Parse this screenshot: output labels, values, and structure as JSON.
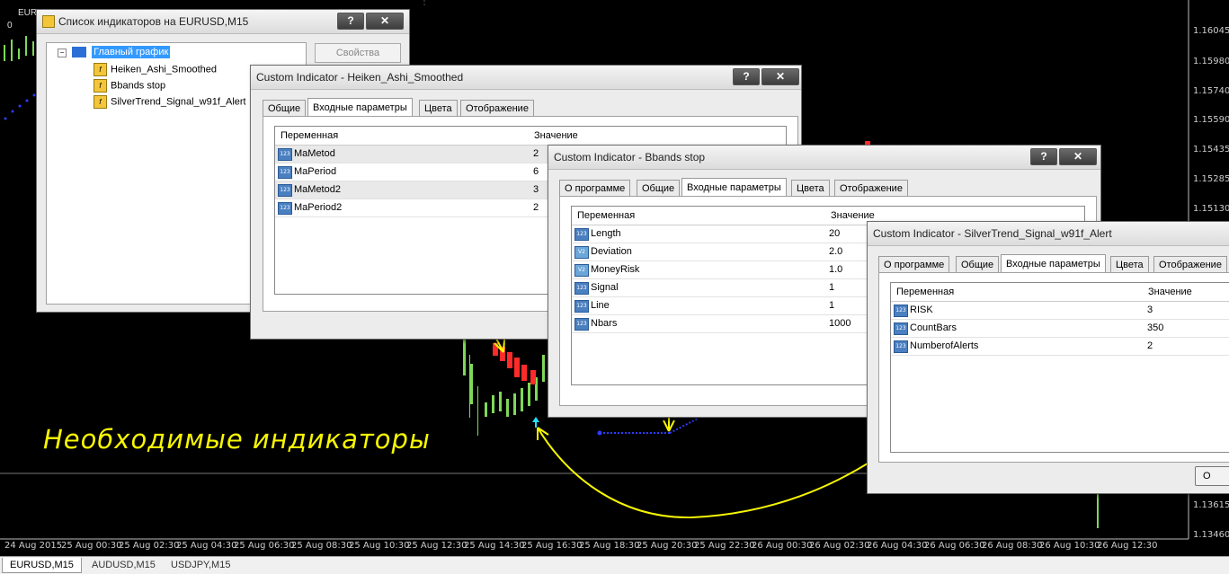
{
  "chart": {
    "symbol": "EURUSD",
    "zero_label": "0",
    "prices": [
      "1.16045",
      "1.15980",
      "1.15740",
      "1.15590",
      "1.15435",
      "1.15285",
      "1.15130",
      "1.13615",
      "1.13460"
    ],
    "times": [
      "24 Aug 2015",
      "25 Aug 00:30",
      "25 Aug 02:30",
      "25 Aug 04:30",
      "25 Aug 06:30",
      "25 Aug 08:30",
      "25 Aug 10:30",
      "25 Aug 12:30",
      "25 Aug 14:30",
      "25 Aug 16:30",
      "25 Aug 18:30",
      "25 Aug 20:30",
      "25 Aug 22:30",
      "26 Aug 00:30",
      "26 Aug 02:30",
      "26 Aug 04:30",
      "26 Aug 06:30",
      "26 Aug 08:30",
      "26 Aug 10:30",
      "26 Aug 12:30"
    ],
    "overlay_caption": "Необходимые индикаторы"
  },
  "symbol_tabs": [
    "EURUSD,M15",
    "AUDUSD,M15",
    "USDJPY,M15"
  ],
  "list_window": {
    "title": "Список индикаторов на EURUSD,M15",
    "help": "?",
    "close": "✕",
    "root": "Главный график",
    "items": [
      "Heiken_Ashi_Smoothed",
      "Bbands stop",
      "SilverTrend_Signal_w91f_Alert"
    ],
    "properties_button": "Свойства"
  },
  "heiken_window": {
    "title": "Custom Indicator - Heiken_Ashi_Smoothed",
    "help": "?",
    "close": "✕",
    "tabs": [
      "Общие",
      "Входные параметры",
      "Цвета",
      "Отображение"
    ],
    "col_variable": "Переменная",
    "col_value": "Значение",
    "rows": [
      {
        "name": "MaMetod",
        "value": "2",
        "icon": "123"
      },
      {
        "name": "MaPeriod",
        "value": "6",
        "icon": "123"
      },
      {
        "name": "MaMetod2",
        "value": "3",
        "icon": "123"
      },
      {
        "name": "MaPeriod2",
        "value": "2",
        "icon": "123"
      }
    ]
  },
  "bbands_window": {
    "title": "Custom Indicator - Bbands stop",
    "help": "?",
    "close": "✕",
    "tabs": [
      "О программе",
      "Общие",
      "Входные параметры",
      "Цвета",
      "Отображение"
    ],
    "col_variable": "Переменная",
    "col_value": "Значение",
    "rows": [
      {
        "name": "Length",
        "value": "20",
        "icon": "123"
      },
      {
        "name": "Deviation",
        "value": "2.0",
        "icon": "V2"
      },
      {
        "name": "MoneyRisk",
        "value": "1.0",
        "icon": "V2"
      },
      {
        "name": "Signal",
        "value": "1",
        "icon": "123"
      },
      {
        "name": "Line",
        "value": "1",
        "icon": "123"
      },
      {
        "name": "Nbars",
        "value": "1000",
        "icon": "123"
      }
    ]
  },
  "silver_window": {
    "title": "Custom Indicator - SilverTrend_Signal_w91f_Alert",
    "tabs": [
      "О программе",
      "Общие",
      "Входные параметры",
      "Цвета",
      "Отображение"
    ],
    "col_variable": "Переменная",
    "col_value": "Значение",
    "rows": [
      {
        "name": "RISK",
        "value": "3",
        "icon": "123"
      },
      {
        "name": "CountBars",
        "value": "350",
        "icon": "123"
      },
      {
        "name": "NumberofAlerts",
        "value": "2",
        "icon": "123"
      }
    ],
    "ok_button": "O"
  },
  "colors": {
    "chart_bg": "#000000",
    "bull": "#7ed957",
    "bear": "#ff2a2a",
    "signal_line": "#2d3cff",
    "arrow": "#ffff33"
  }
}
